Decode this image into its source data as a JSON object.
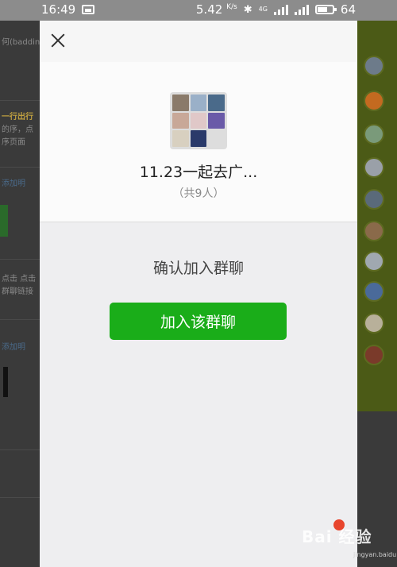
{
  "status_bar": {
    "time": "16:49",
    "speed": "5.42",
    "speed_unit": "K/s",
    "network_label": "4G",
    "battery": "64"
  },
  "background": {
    "left_snippets": [
      "何(baddin",
      "一行出行",
      "的序，点",
      "序页面",
      "添加明",
      "点击 点击",
      "群聊链接",
      "添加明"
    ]
  },
  "modal": {
    "close_icon": "close-icon",
    "group_name": "11.23一起去广...",
    "member_count": "（共9人）",
    "confirm_text": "确认加入群聊",
    "join_button_label": "加入该群聊"
  },
  "watermark": {
    "text": "Bai 经验",
    "sub": "jingyan.baidu.com"
  },
  "colors": {
    "accent": "#1aad19",
    "modal_bg": "#eeeef0",
    "status_bar_bg": "#8c8c8c"
  }
}
